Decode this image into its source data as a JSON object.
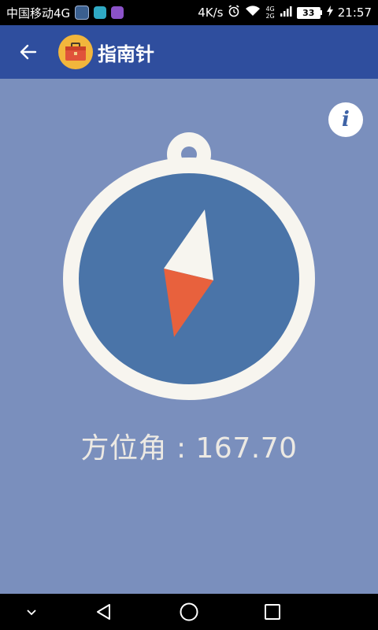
{
  "status_bar": {
    "carrier": "中国移动4G",
    "speed": "4K/s",
    "battery": "33",
    "time": "21:57",
    "net_top": "4G",
    "net_bottom": "2G"
  },
  "app_bar": {
    "title": "指南针",
    "back_icon": "arrow-left-icon",
    "logo_icon": "toolbox-icon"
  },
  "compass": {
    "heading_degrees": 167.7,
    "colors": {
      "ring": "#f7f5ef",
      "face": "#4a74a8",
      "needle_north": "#f7f5ef",
      "needle_south": "#e8613d"
    }
  },
  "azimuth": {
    "label": "方位角",
    "separator": " : ",
    "value": "167.70"
  },
  "info_button": {
    "icon": "info-icon",
    "glyph": "i"
  },
  "nav_bar": {
    "collapse_icon": "chevron-down-icon",
    "back_icon": "triangle-back-icon",
    "home_icon": "circle-home-icon",
    "recents_icon": "square-recents-icon"
  },
  "theme": {
    "background": "#7a8fbd",
    "app_bar": "#2f4e9e"
  }
}
